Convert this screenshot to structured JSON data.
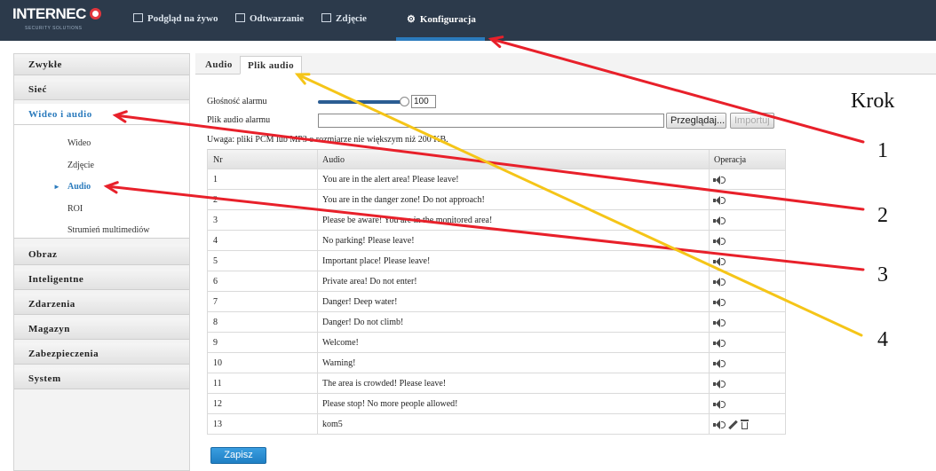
{
  "app": {
    "logo_text": "INTERNEC",
    "logo_subtitle": "SECURITY SOLUTIONS"
  },
  "nav": {
    "items": [
      {
        "label": "Podgląd na żywo",
        "icon": "monitor-icon"
      },
      {
        "label": "Odtwarzanie",
        "icon": "film-icon"
      },
      {
        "label": "Zdjęcie",
        "icon": "picture-icon"
      },
      {
        "label": "Konfiguracja",
        "icon": "gear-icon",
        "active": true
      }
    ]
  },
  "sidebar": {
    "groups": [
      {
        "label": "Zwykłe"
      },
      {
        "label": "Sieć"
      },
      {
        "label": "Wideo i audio",
        "active": true
      },
      {
        "label": "Obraz"
      },
      {
        "label": "Inteligentne"
      },
      {
        "label": "Zdarzenia"
      },
      {
        "label": "Magazyn"
      },
      {
        "label": "Zabezpieczenia"
      },
      {
        "label": "System"
      }
    ],
    "sub_items": [
      {
        "label": "Wideo"
      },
      {
        "label": "Zdjęcie"
      },
      {
        "label": "Audio",
        "active": true
      },
      {
        "label": "ROI"
      },
      {
        "label": "Strumień multimediów"
      }
    ]
  },
  "tabs": [
    {
      "label": "Audio"
    },
    {
      "label": "Plik audio",
      "active": true
    }
  ],
  "form": {
    "volume_label": "Głośność alarmu",
    "volume_value": "100",
    "volume_level": 1.0,
    "file_label": "Plik audio alarmu",
    "file_value": "",
    "browse_label": "Przeglądaj...",
    "import_label": "Importuj",
    "note": "Uwaga: pliki PCM lub MP3 o rozmiarze nie większym niż 200 KB."
  },
  "table": {
    "headers": [
      "Nr",
      "Audio",
      "Operacja"
    ],
    "rows": [
      {
        "nr": "1",
        "audio": "You are in the alert area! Please leave!"
      },
      {
        "nr": "2",
        "audio": "You are in the danger zone! Do not approach!"
      },
      {
        "nr": "3",
        "audio": "Please be aware! You are in the monitored area!"
      },
      {
        "nr": "4",
        "audio": "No parking! Please leave!"
      },
      {
        "nr": "5",
        "audio": "Important place! Please leave!"
      },
      {
        "nr": "6",
        "audio": "Private area! Do not enter!"
      },
      {
        "nr": "7",
        "audio": "Danger! Deep water!"
      },
      {
        "nr": "8",
        "audio": "Danger! Do not climb!"
      },
      {
        "nr": "9",
        "audio": "Welcome!"
      },
      {
        "nr": "10",
        "audio": "Warning!"
      },
      {
        "nr": "11",
        "audio": "The area is crowded! Please leave!"
      },
      {
        "nr": "12",
        "audio": "Please stop! No more people allowed!"
      },
      {
        "nr": "13",
        "audio": "kom5",
        "custom": true
      }
    ]
  },
  "save_label": "Zapisz",
  "annotations": {
    "krok_label": "Krok",
    "steps": [
      "1",
      "2",
      "3",
      "4"
    ],
    "arrow_color_red": "#e8202a",
    "arrow_color_yellow": "#f5c518"
  },
  "colors": {
    "topbar": "#2c3a4b",
    "accent": "#2b7bbd"
  }
}
